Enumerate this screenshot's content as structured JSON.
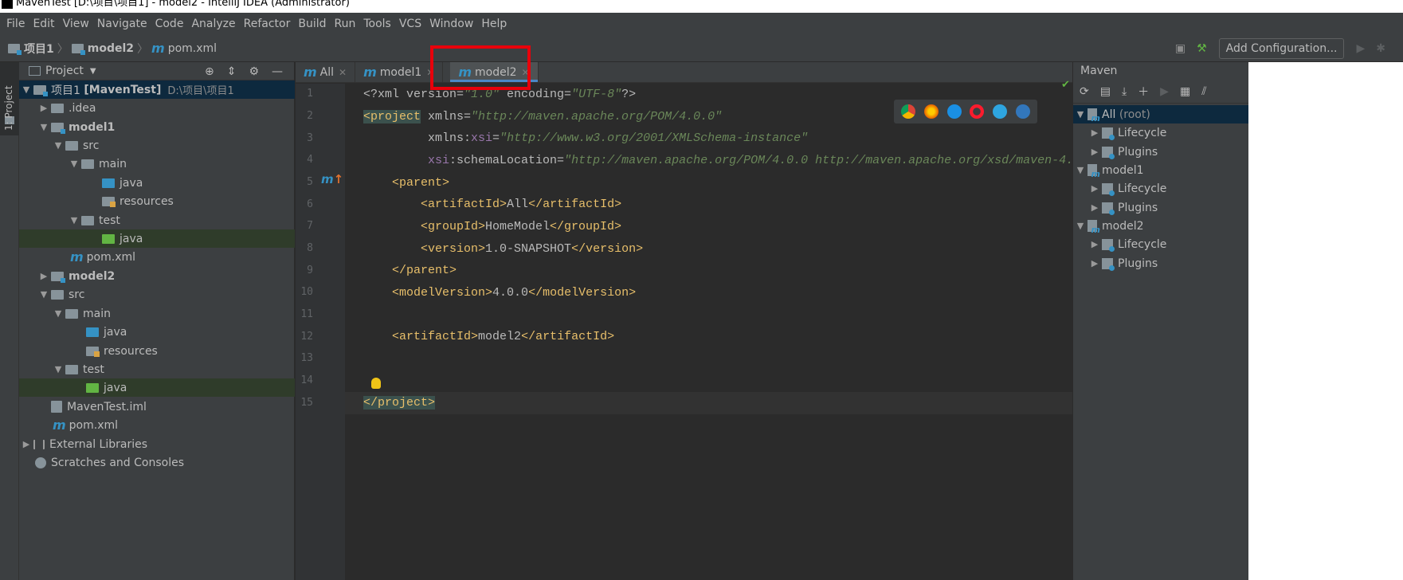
{
  "window": {
    "title": "MavenTest [D:\\项目\\项目1] - model2 - IntelliJ IDEA (Administrator)"
  },
  "menu": [
    "File",
    "Edit",
    "View",
    "Navigate",
    "Code",
    "Analyze",
    "Refactor",
    "Build",
    "Run",
    "Tools",
    "VCS",
    "Window",
    "Help"
  ],
  "breadcrumb": {
    "root": "项目1",
    "module": "model2",
    "file": "pom.xml"
  },
  "toolbar": {
    "add_configuration": "Add Configuration..."
  },
  "leftstrip": {
    "project_tab": "1: Project"
  },
  "project_panel": {
    "title": "Project",
    "tree": [
      {
        "label": "项目1",
        "bold_suffix": "[MavenTest]",
        "path": "D:\\项目\\项目1"
      },
      {
        "label": ".idea"
      },
      {
        "label": "model1"
      },
      {
        "label": "src"
      },
      {
        "label": "main"
      },
      {
        "label": "java"
      },
      {
        "label": "resources"
      },
      {
        "label": "test"
      },
      {
        "label": "java"
      },
      {
        "label": "pom.xml"
      },
      {
        "label": "model2"
      },
      {
        "label": "src"
      },
      {
        "label": "main"
      },
      {
        "label": "java"
      },
      {
        "label": "resources"
      },
      {
        "label": "test"
      },
      {
        "label": "java"
      },
      {
        "label": "MavenTest.iml"
      },
      {
        "label": "pom.xml"
      },
      {
        "label": "External Libraries"
      },
      {
        "label": "Scratches and Consoles"
      }
    ]
  },
  "editor_tabs": [
    {
      "label": "All"
    },
    {
      "label": "model1"
    },
    {
      "label": "model2"
    }
  ],
  "line_numbers": [
    "1",
    "2",
    "3",
    "4",
    "5",
    "6",
    "7",
    "8",
    "9",
    "10",
    "11",
    "12",
    "13",
    "14",
    "15"
  ],
  "code": {
    "l1_a": "<?xml version=",
    "l1_b": "\"1.0\"",
    "l1_c": " encoding=",
    "l1_d": "\"UTF-8\"",
    "l1_e": "?>",
    "l2_tag": "<project",
    "l2_attr": " xmlns=",
    "l2_val": "\"http://maven.apache.org/POM/4.0.0\"",
    "l3_ns": "xsi",
    "l3_pre": "xmlns:",
    "l3_eq": "=",
    "l3_val": "\"http://www.w3.org/2001/XMLSchema-instance\"",
    "l4_ns": "xsi",
    "l4_post": ":schemaLocation=",
    "l4_val": "\"http://maven.apache.org/POM/4.0.0 http://maven.apache.org/xsd/maven-4.0",
    "l5": "<parent>",
    "l6_open": "<artifactId>",
    "l6_text": "All",
    "l6_close": "</artifactId>",
    "l7_open": "<groupId>",
    "l7_text": "HomeModel",
    "l7_close": "</groupId>",
    "l8_open": "<version>",
    "l8_text": "1.0-SNAPSHOT",
    "l8_close": "</version>",
    "l9": "</parent>",
    "l10_open": "<modelVersion>",
    "l10_text": "4.0.0",
    "l10_close": "</modelVersion>",
    "l12_open": "<artifactId>",
    "l12_text": "model2",
    "l12_close": "</artifactId>",
    "l15": "</project>"
  },
  "maven_panel": {
    "title": "Maven",
    "tree": [
      {
        "label": "All",
        "suffix": "(root)"
      },
      {
        "label": "Lifecycle"
      },
      {
        "label": "Plugins"
      },
      {
        "label": "model1"
      },
      {
        "label": "Lifecycle"
      },
      {
        "label": "Plugins"
      },
      {
        "label": "model2"
      },
      {
        "label": "Lifecycle"
      },
      {
        "label": "Plugins"
      }
    ]
  },
  "colors": {
    "background": "#2b2b2b",
    "panel": "#3c3f41",
    "selection": "#0d293e",
    "accent": "#4a88c7",
    "highlight_box": "#e8000b"
  }
}
